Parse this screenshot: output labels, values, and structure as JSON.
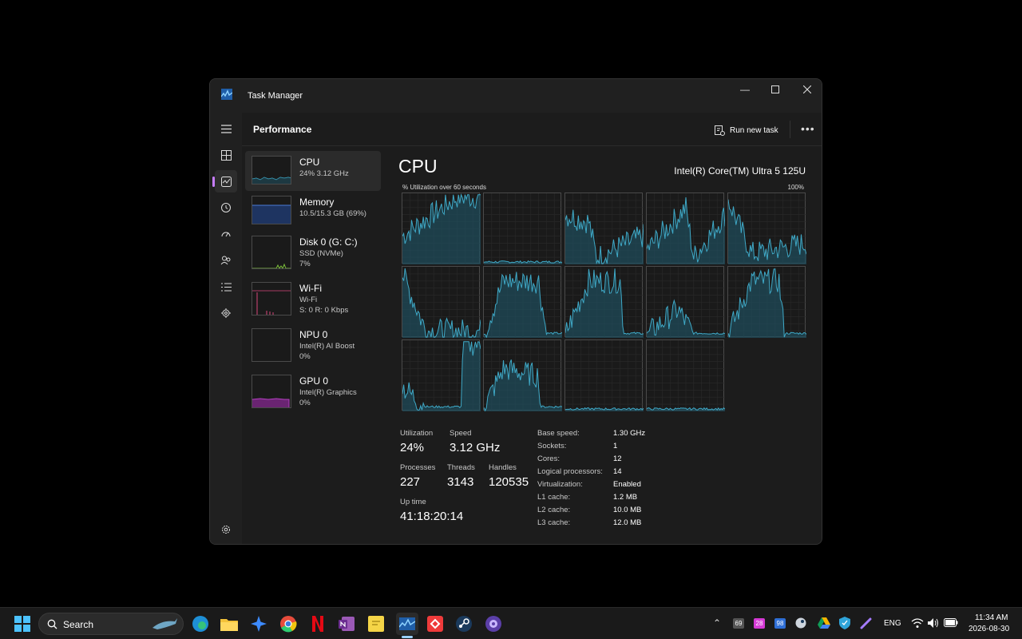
{
  "window": {
    "title": "Task Manager"
  },
  "header": {
    "page_title": "Performance",
    "run_new_task": "Run new task"
  },
  "devices": [
    {
      "name": "CPU",
      "sub1": "24%  3.12 GHz",
      "sub2": ""
    },
    {
      "name": "Memory",
      "sub1": "10.5/15.3 GB (69%)",
      "sub2": ""
    },
    {
      "name": "Disk 0 (G: C:)",
      "sub1": "SSD (NVMe)",
      "sub2": "7%"
    },
    {
      "name": "Wi-Fi",
      "sub1": "Wi-Fi",
      "sub2": "S: 0 R: 0 Kbps"
    },
    {
      "name": "NPU 0",
      "sub1": "Intel(R) AI Boost",
      "sub2": "0%"
    },
    {
      "name": "GPU 0",
      "sub1": "Intel(R) Graphics",
      "sub2": "0%"
    }
  ],
  "cpu": {
    "title": "CPU",
    "model": "Intel(R) Core(TM) Ultra 5 125U",
    "graph_label": "% Utilization over 60 seconds",
    "graph_max": "100%",
    "logical_processor_graphs": 14,
    "stats": {
      "utilization_label": "Utilization",
      "utilization": "24%",
      "speed_label": "Speed",
      "speed": "3.12 GHz",
      "processes_label": "Processes",
      "processes": "227",
      "threads_label": "Threads",
      "threads": "3143",
      "handles_label": "Handles",
      "handles": "120535",
      "uptime_label": "Up time",
      "uptime": "41:18:20:14"
    },
    "specs": [
      {
        "k": "Base speed:",
        "v": "1.30 GHz"
      },
      {
        "k": "Sockets:",
        "v": "1"
      },
      {
        "k": "Cores:",
        "v": "12"
      },
      {
        "k": "Logical processors:",
        "v": "14"
      },
      {
        "k": "Virtualization:",
        "v": "Enabled"
      },
      {
        "k": "L1 cache:",
        "v": "1.2 MB"
      },
      {
        "k": "L2 cache:",
        "v": "10.0 MB"
      },
      {
        "k": "L3 cache:",
        "v": "12.0 MB"
      }
    ]
  },
  "colors": {
    "cpu": "#3fa9c7",
    "memory": "#4a7bd6",
    "disk": "#7cbf3a",
    "wifi": "#d6477b",
    "gpu": "#b23fbf",
    "accent": "#c77dff"
  },
  "taskbar": {
    "search_label": "Search",
    "lang": "ENG",
    "time": "11:34 AM",
    "date": "2026-08-30",
    "badges": [
      "69",
      "28",
      "98"
    ]
  }
}
